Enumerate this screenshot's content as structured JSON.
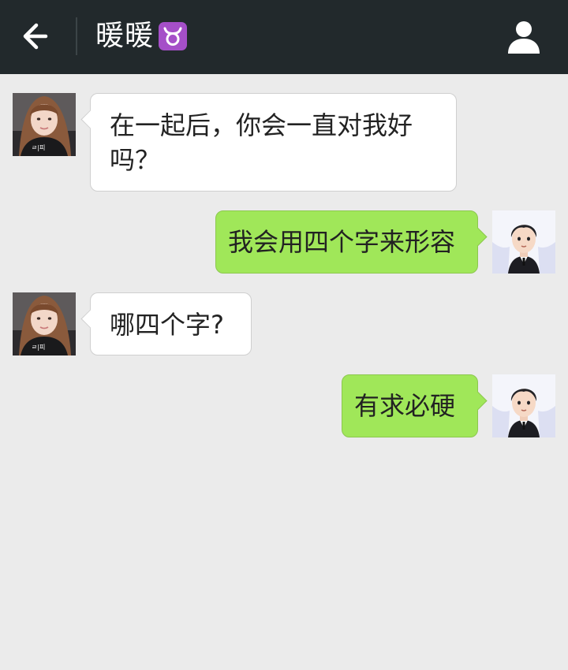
{
  "header": {
    "title": "暖暖",
    "back_icon": "arrow-left-icon",
    "zodiac_icon": "taurus-icon",
    "zodiac_glyph": "♉",
    "profile_icon": "person-icon",
    "background_color": "#22292c"
  },
  "messages": [
    {
      "sender": "contact",
      "text": "在一起后，你会一直对我好吗？"
    },
    {
      "sender": "me",
      "text": "我会用四个字来形容"
    },
    {
      "sender": "contact",
      "text": "哪四个字?"
    },
    {
      "sender": "me",
      "text": "有求必硬"
    }
  ],
  "colors": {
    "chat_background": "#ebebeb",
    "incoming_bubble": "#ffffff",
    "outgoing_bubble": "#a0e759",
    "zodiac_badge": "#a54fc8"
  }
}
